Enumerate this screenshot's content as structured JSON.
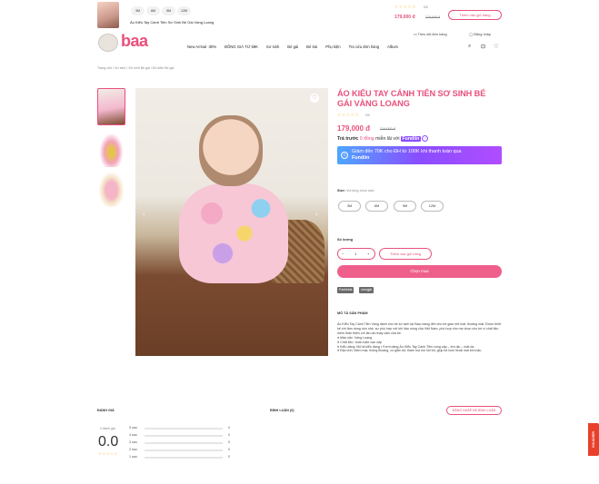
{
  "sticky_bar": {
    "sizes": [
      "3M",
      "6M",
      "9M",
      "12M"
    ],
    "product_name": "Áo Kiểu Tay Cánh Tiên Sơ Sinh Bé Gái Vàng Loang",
    "rating": "0/0",
    "price": "179,000 đ",
    "old_price": "219,000 đ",
    "add_to_cart": "Thêm vào giỏ hàng"
  },
  "header": {
    "logo": "baa",
    "track_order": "Theo dõi đơn hàng",
    "login": "Đăng nhập",
    "nav": [
      "New Arrival -30%",
      "ĐỒNG GIÁ TỪ 59K",
      "Sơ sinh",
      "Bé gái",
      "Bé trai",
      "Phụ kiện",
      "Tra cứu đơn hàng",
      "Album"
    ]
  },
  "breadcrumb": "Trang chủ / Sơ sinh / Sơ sinh Bé gái / Đồ kiểu Bé gái",
  "product": {
    "title": "ÁO KIỂU TAY CÁNH TIÊN SƠ SINH BÉ GÁI VÀNG LOANG",
    "rating": "0/0",
    "price": "179,000 đ",
    "old_price": "219,000 đ",
    "installment_prefix": "Trả trước",
    "installment_value": "0 đồng",
    "installment_suffix": "miễn lãi với",
    "fundiin": "Fundiin",
    "promo_line1": "Giảm đến 70K cho ĐH từ 100K khi thanh toán qua",
    "promo_line2": "Fundiin",
    "size_label": "Size:",
    "size_hint": "Vui lòng chọn size",
    "sizes": [
      "3M",
      "6M",
      "9M",
      "12M"
    ],
    "qty_label": "Số lượng",
    "qty": "1",
    "minus": "−",
    "plus": "+",
    "add_to_cart": "Thêm vào giỏ hàng",
    "buy_now": "Chọn mua",
    "tags": [
      "Fashkids",
      "clongjai"
    ]
  },
  "description": {
    "heading": "MÔ TẢ SẢN PHẨM",
    "text": "Áo Kiểu Tay Cánh Tiên Vàng dành cho bé sơ sinh tại Baa mang đến cho bé giao nét mát, thoáng mát. Được thiết kế với tâm dung nón nhẹ, sự phù hợp với khí hậu nóng của Việt Nam, phù hợp cho mẹ chọn cho bé vì chất liệu mềm thân thiện với làn da nhạy cảm của bé.",
    "bullets": [
      "● Màu sắc: Vàng Loang",
      "● Chất liệu: Voan kate cao cấp",
      "● Kiểu dáng: Mô tả kiểu dáng • Form dáng Áo Kiểu Tay Cánh Tiên cùng cấp – êm dịu – mát da",
      "● Đặc tính: Mềm mại, thông thoáng, co giãn tốt, thấm hút mồ hôi tốt, giúp bé luôn thoải mái khi mặc."
    ]
  },
  "reviews": {
    "heading": "ĐÁNH GIÁ",
    "count_label": "0 đánh giá",
    "avg": "0.0",
    "rows": [
      {
        "label": "5 sao",
        "value": 0
      },
      {
        "label": "4 sao",
        "value": 0
      },
      {
        "label": "3 sao",
        "value": 0
      },
      {
        "label": "2 sao",
        "value": 0
      },
      {
        "label": "1 sao",
        "value": 0
      }
    ]
  },
  "comments": {
    "heading": "BÌNH LUẬN (0)",
    "login_btn": "ĐĂNG NHẬP ĐỂ BÌNH LUẬN"
  },
  "voucher": "VOUCHER",
  "colors": {
    "accent": "#e8507c",
    "promo_start": "#4da6ff",
    "promo_end": "#b04dff"
  }
}
